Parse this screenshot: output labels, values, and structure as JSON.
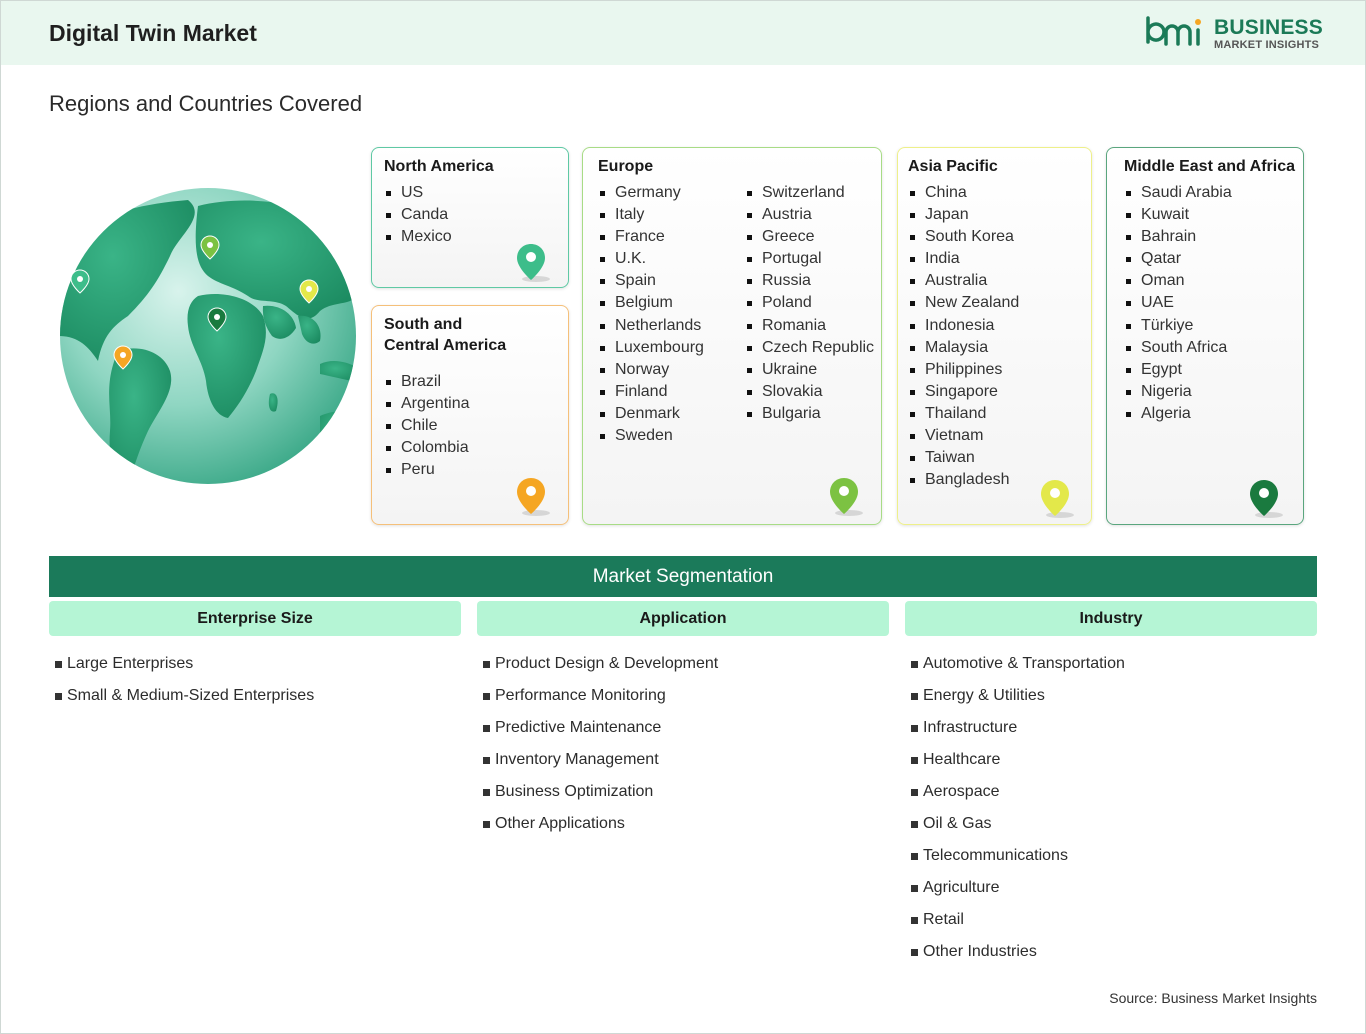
{
  "header": {
    "title": "Digital Twin Market",
    "logo_line1": "BUSINESS",
    "logo_line2": "MARKET INSIGHTS"
  },
  "subtitle": "Regions and Countries Covered",
  "colors": {
    "brand_green": "#1b7a5a",
    "segment_header": "#b5f5d5",
    "pin_north_america": "#3dbd8a",
    "pin_south_america": "#f5a623",
    "pin_europe": "#7cc242",
    "pin_asia_pacific": "#e3e84a",
    "pin_middle_east_africa": "#1a7a3f"
  },
  "regions": [
    {
      "name": "North America",
      "countries": [
        "US",
        "Canda",
        "Mexico"
      ]
    },
    {
      "name": "South and\nCentral America",
      "countries": [
        "Brazil",
        "Argentina",
        "Chile",
        "Colombia",
        "Peru"
      ]
    },
    {
      "name": "Europe",
      "countries_col1": [
        "Germany",
        "Italy",
        "France",
        "U.K.",
        "Spain",
        "Belgium",
        "Netherlands",
        "Luxembourg",
        "Norway",
        "Finland",
        "Denmark",
        "Sweden"
      ],
      "countries_col2": [
        "Switzerland",
        "Austria",
        "Greece",
        "Portugal",
        "Russia",
        "Poland",
        "Romania",
        "Czech Republic",
        "Ukraine",
        "Slovakia",
        "Bulgaria"
      ]
    },
    {
      "name": "Asia Pacific",
      "countries": [
        "China",
        "Japan",
        "South Korea",
        "India",
        "Australia",
        "New Zealand",
        "Indonesia",
        "Malaysia",
        "Philippines",
        "Singapore",
        "Thailand",
        "Vietnam",
        "Taiwan",
        "Bangladesh"
      ]
    },
    {
      "name": "Middle East and Africa",
      "countries": [
        "Saudi Arabia",
        "Kuwait",
        "Bahrain",
        "Qatar",
        "Oman",
        "UAE",
        "Türkiye",
        "South Africa",
        "Egypt",
        "Nigeria",
        "Algeria"
      ]
    }
  ],
  "segmentation": {
    "title": "Market Segmentation",
    "columns": [
      {
        "header": "Enterprise Size",
        "items": [
          "Large Enterprises",
          "Small & Medium-Sized Enterprises"
        ]
      },
      {
        "header": "Application",
        "items": [
          "Product Design & Development",
          "Performance Monitoring",
          "Predictive Maintenance",
          "Inventory Management",
          "Business Optimization",
          "Other Applications"
        ]
      },
      {
        "header": "Industry",
        "items": [
          "Automotive & Transportation",
          "Energy & Utilities",
          "Infrastructure",
          "Healthcare",
          "Aerospace",
          "Oil & Gas",
          "Telecommunications",
          "Agriculture",
          "Retail",
          "Other Industries"
        ]
      }
    ]
  },
  "source": "Source: Business Market Insights"
}
